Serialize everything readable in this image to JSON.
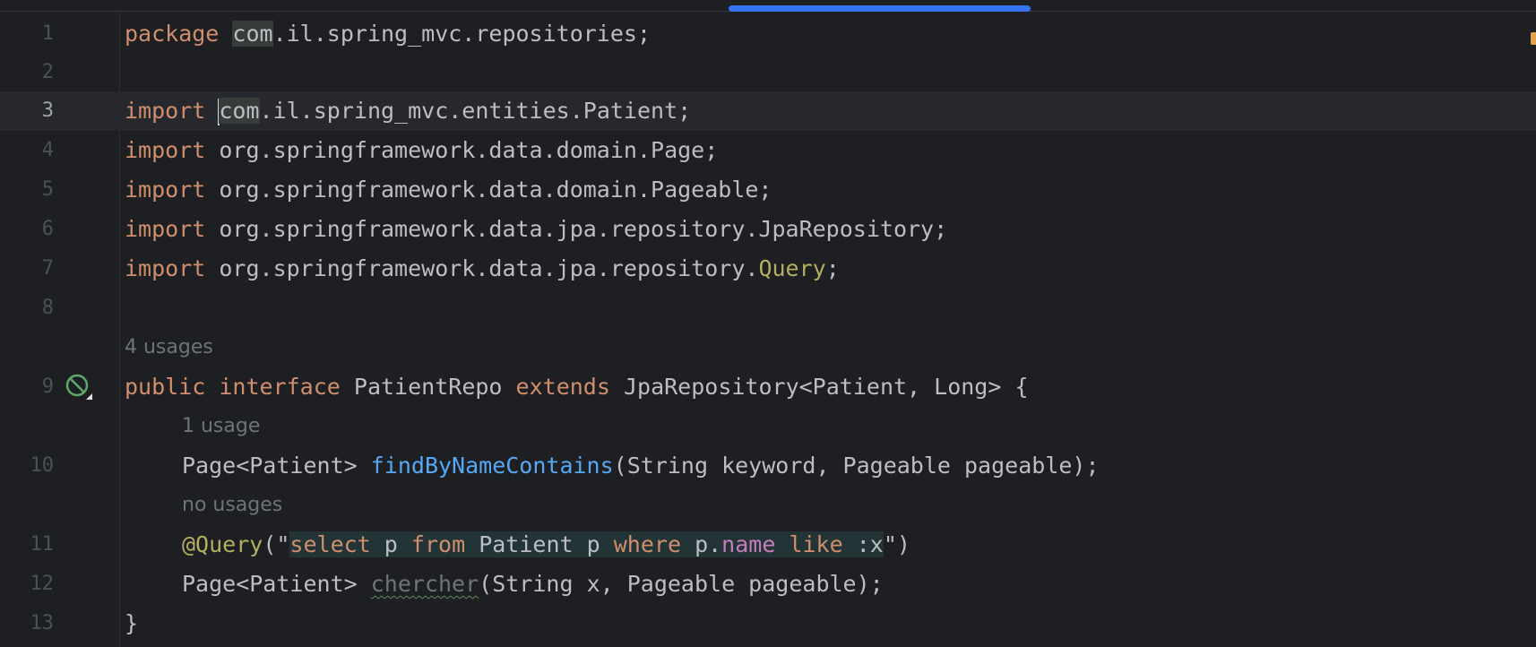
{
  "editor": {
    "file_path": "package com.il.spring_mvc.repositories;",
    "lines": [
      {
        "n": "1"
      },
      {
        "n": "2"
      },
      {
        "n": "3"
      },
      {
        "n": "4"
      },
      {
        "n": "5"
      },
      {
        "n": "6"
      },
      {
        "n": "7"
      },
      {
        "n": "8"
      },
      {
        "n": "9"
      },
      {
        "n": "10"
      },
      {
        "n": "11"
      },
      {
        "n": "12"
      },
      {
        "n": "13"
      }
    ],
    "tokens": {
      "package_kw": "package",
      "package_name_hl": "com",
      "package_name_rest": ".il.spring_mvc.repositories;",
      "import_kw": "import",
      "import3_hl": "com",
      "import3_rest": ".il.spring_mvc.entities.Patient;",
      "import4": "org.springframework.data.domain.Page;",
      "import5": "org.springframework.data.domain.Pageable;",
      "import6": "org.springframework.data.jpa.repository.JpaRepository;",
      "import7_pre": "org.springframework.data.jpa.repository.",
      "import7_query": "Query",
      "import7_end": ";",
      "public_kw": "public",
      "interface_kw": "interface",
      "repo_name": "PatientRepo",
      "extends_kw": "extends",
      "repo_super": "JpaRepository<Patient, Long> {",
      "l10_type": "Page<Patient>",
      "l10_method": "findByNameContains",
      "l10_params": "(String keyword, Pageable pageable);",
      "l11_ann": "@Query",
      "l11_open": "(\"",
      "q_select": "select",
      "q_p1": "p",
      "q_from": "from",
      "q_entity": "Patient p",
      "q_where": "where",
      "q_pdot": "p.",
      "q_name": "name",
      "q_like": "like",
      "q_param": ":x",
      "l11_close_quote": "\"",
      "l11_close": ")",
      "l12_type": "Page<Patient>",
      "l12_method": "chercher",
      "l12_params": "(String x, Pageable pageable);",
      "l13": "}"
    },
    "hints": {
      "interface_usages": "4 usages",
      "method1_usages": "1 usage",
      "method2_usages": "no usages"
    },
    "gutter_icon": "implemented-interface-icon",
    "colors": {
      "background": "#1e1f22",
      "keyword": "#cf8e6d",
      "method": "#56a8f5",
      "annotation": "#b3ae60",
      "field": "#c77dbb",
      "text": "#bcbec4",
      "accent": "#3574f0"
    }
  }
}
